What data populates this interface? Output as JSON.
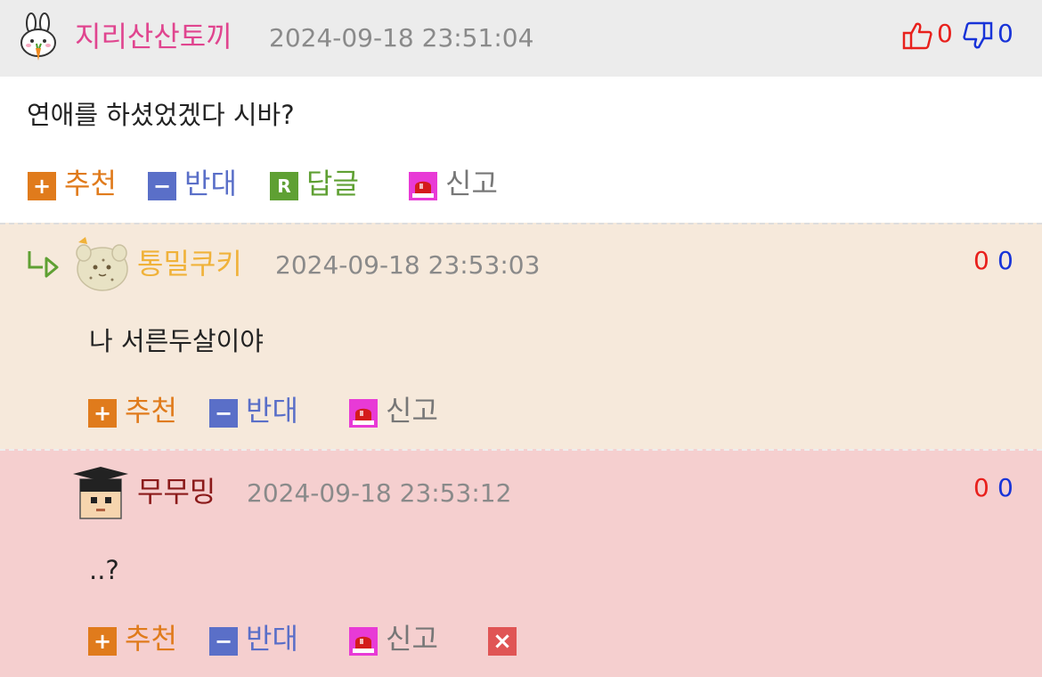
{
  "comments": [
    {
      "nickname": "지리산산토끼",
      "timestamp": "2024-09-18 23:51:04",
      "content": "연애를 하셨었겠다 시바?",
      "upvotes": "0",
      "downvotes": "0",
      "actions": {
        "recommend": "추천",
        "oppose": "반대",
        "reply": "답글",
        "report": "신고"
      }
    },
    {
      "nickname": "통밀쿠키",
      "timestamp": "2024-09-18 23:53:03",
      "content": "나 서른두살이야",
      "upvotes": "0",
      "downvotes": "0",
      "actions": {
        "recommend": "추천",
        "oppose": "반대",
        "report": "신고"
      }
    },
    {
      "nickname": "무무밍",
      "timestamp": "2024-09-18 23:53:12",
      "content": "..?",
      "upvotes": "0",
      "downvotes": "0",
      "actions": {
        "recommend": "추천",
        "oppose": "반대",
        "report": "신고"
      }
    }
  ],
  "icons": {
    "plus": "+",
    "minus": "−",
    "reply": "R",
    "delete": "×",
    "reply_arrow": "reply-arrow-icon",
    "thumbs_up": "thumbs-up-icon",
    "thumbs_down": "thumbs-down-icon",
    "siren": "siren-icon"
  },
  "colors": {
    "nick_main": "#e0458f",
    "nick_reply1": "#f0b23a",
    "nick_reply2": "#8b1a1a",
    "recommend": "#e07b1c",
    "oppose": "#5a6fc8",
    "reply": "#5fa033",
    "report": "#777777",
    "delete": "#e05555",
    "up_count": "#e8201c",
    "down_count": "#1833d8"
  }
}
